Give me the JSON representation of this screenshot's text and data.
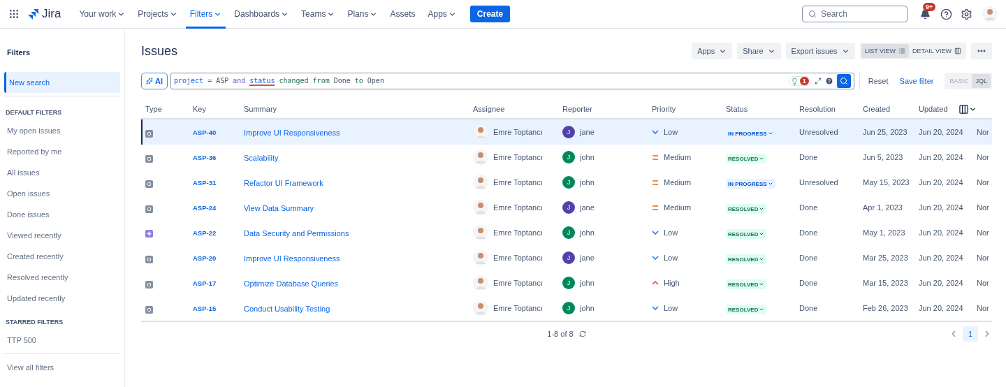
{
  "topbar": {
    "product": "Jira",
    "nav": [
      {
        "label": "Your work",
        "has_menu": true,
        "selected": false
      },
      {
        "label": "Projects",
        "has_menu": true,
        "selected": false
      },
      {
        "label": "Filters",
        "has_menu": true,
        "selected": true
      },
      {
        "label": "Dashboards",
        "has_menu": true,
        "selected": false
      },
      {
        "label": "Teams",
        "has_menu": true,
        "selected": false
      },
      {
        "label": "Plans",
        "has_menu": true,
        "selected": false
      },
      {
        "label": "Assets",
        "has_menu": false,
        "selected": false
      },
      {
        "label": "Apps",
        "has_menu": true,
        "selected": false
      }
    ],
    "create": "Create",
    "search": {
      "placeholder": "Search"
    },
    "notifications": "9+"
  },
  "sidebar": {
    "title": "Filters",
    "top": [
      {
        "label": "New search",
        "selected": true
      }
    ],
    "sections": [
      {
        "heading": "DEFAULT FILTERS",
        "items": [
          {
            "label": "My open issues",
            "selected": false
          },
          {
            "label": "Reported by me",
            "selected": false
          },
          {
            "label": "All issues",
            "selected": false
          },
          {
            "label": "Open issues",
            "selected": false
          },
          {
            "label": "Done issues",
            "selected": false
          },
          {
            "label": "Viewed recently",
            "selected": false
          },
          {
            "label": "Created recently",
            "selected": false
          },
          {
            "label": "Resolved recently",
            "selected": false
          },
          {
            "label": "Updated recently",
            "selected": false
          }
        ]
      },
      {
        "heading": "STARRED FILTERS",
        "items": [
          {
            "label": "TTP 500",
            "selected": false
          }
        ]
      }
    ],
    "footer": "View all filters"
  },
  "page": {
    "title": "Issues",
    "actions": [
      "Apps",
      "Share",
      "Export issues"
    ],
    "views": [
      {
        "label": "LIST VIEW",
        "kind": "list",
        "selected": true
      },
      {
        "label": "DETAIL VIEW",
        "kind": "detail",
        "selected": false
      }
    ]
  },
  "query": {
    "ai": "AI",
    "tokens": [
      {
        "text": "project",
        "kind": "field",
        "flagged": false
      },
      {
        "text": "=",
        "kind": "operator",
        "flagged": false
      },
      {
        "text": "ASP",
        "kind": "value",
        "flagged": false
      },
      {
        "text": "and",
        "kind": "keyword",
        "flagged": false
      },
      {
        "text": "status",
        "kind": "field",
        "flagged": true
      },
      {
        "text": "changed",
        "kind": "predicate",
        "flagged": false
      },
      {
        "text": "from",
        "kind": "predicate",
        "flagged": false
      },
      {
        "text": "Done",
        "kind": "value",
        "flagged": false
      },
      {
        "text": "to",
        "kind": "predicate",
        "flagged": false
      },
      {
        "text": "Open",
        "kind": "value",
        "flagged": false
      }
    ],
    "error_count": "1",
    "reset": "Reset",
    "save": "Save filter",
    "modes": [
      {
        "label": "BASIC",
        "selected": false
      },
      {
        "label": "JQL",
        "selected": true
      }
    ]
  },
  "table": {
    "columns": [
      "Type",
      "Key",
      "Summary",
      "Assignee",
      "Reporter",
      "Priority",
      "Status",
      "Resolution",
      "Created",
      "Updated"
    ],
    "rows": [
      {
        "type": {
          "kind": "task"
        },
        "key": "ASP-40",
        "summary": "Improve UI Responsiveness",
        "assignee": "Emre Toptancı",
        "reporter": {
          "name": "jane",
          "initial": "J",
          "color": "#5243aa"
        },
        "priority": {
          "label": "Low",
          "kind": "low"
        },
        "status": {
          "label": "IN PROGRESS",
          "kind": "in_progress"
        },
        "resolution": "Unresolved",
        "created": "Jun 25, 2023",
        "updated": "Jun 20, 2024",
        "column_11": "Nor",
        "selected": true
      },
      {
        "type": {
          "kind": "task"
        },
        "key": "ASP-36",
        "summary": "Scalability",
        "assignee": "Emre Toptancı",
        "reporter": {
          "name": "john",
          "initial": "J",
          "color": "#00875a"
        },
        "priority": {
          "label": "Medium",
          "kind": "medium"
        },
        "status": {
          "label": "RESOLVED",
          "kind": "resolved"
        },
        "resolution": "Done",
        "created": "Jun 5, 2023",
        "updated": "Jun 20, 2024",
        "column_11": "Nor",
        "selected": false
      },
      {
        "type": {
          "kind": "task"
        },
        "key": "ASP-31",
        "summary": "Refactor UI Framework",
        "assignee": "Emre Toptancı",
        "reporter": {
          "name": "john",
          "initial": "J",
          "color": "#00875a"
        },
        "priority": {
          "label": "Medium",
          "kind": "medium"
        },
        "status": {
          "label": "IN PROGRESS",
          "kind": "in_progress"
        },
        "resolution": "Unresolved",
        "created": "May 15, 2023",
        "updated": "Jun 20, 2024",
        "column_11": "Nor",
        "selected": false
      },
      {
        "type": {
          "kind": "task"
        },
        "key": "ASP-24",
        "summary": "View Data Summary",
        "assignee": "Emre Toptancı",
        "reporter": {
          "name": "jane",
          "initial": "J",
          "color": "#5243aa"
        },
        "priority": {
          "label": "Medium",
          "kind": "medium"
        },
        "status": {
          "label": "RESOLVED",
          "kind": "resolved"
        },
        "resolution": "Done",
        "created": "Apr 1, 2023",
        "updated": "Jun 20, 2024",
        "column_11": "Nor",
        "selected": false
      },
      {
        "type": {
          "kind": "epic"
        },
        "key": "ASP-22",
        "summary": "Data Security and Permissions",
        "assignee": "Emre Toptancı",
        "reporter": {
          "name": "john",
          "initial": "J",
          "color": "#00875a"
        },
        "priority": {
          "label": "Low",
          "kind": "low"
        },
        "status": {
          "label": "RESOLVED",
          "kind": "resolved"
        },
        "resolution": "Done",
        "created": "May 1, 2023",
        "updated": "Jun 20, 2024",
        "column_11": "Nor",
        "selected": false
      },
      {
        "type": {
          "kind": "task"
        },
        "key": "ASP-20",
        "summary": "Improve UI Responsiveness",
        "assignee": "Emre Toptancı",
        "reporter": {
          "name": "jane",
          "initial": "J",
          "color": "#5243aa"
        },
        "priority": {
          "label": "Low",
          "kind": "low"
        },
        "status": {
          "label": "RESOLVED",
          "kind": "resolved"
        },
        "resolution": "Done",
        "created": "Mar 25, 2023",
        "updated": "Jun 20, 2024",
        "column_11": "Nor",
        "selected": false
      },
      {
        "type": {
          "kind": "task"
        },
        "key": "ASP-17",
        "summary": "Optimize Database Queries",
        "assignee": "Emre Toptancı",
        "reporter": {
          "name": "john",
          "initial": "J",
          "color": "#00875a"
        },
        "priority": {
          "label": "High",
          "kind": "high"
        },
        "status": {
          "label": "RESOLVED",
          "kind": "resolved"
        },
        "resolution": "Done",
        "created": "Mar 15, 2023",
        "updated": "Jun 20, 2024",
        "column_11": "Nor",
        "selected": false
      },
      {
        "type": {
          "kind": "task"
        },
        "key": "ASP-15",
        "summary": "Conduct Usability Testing",
        "assignee": "Emre Toptancı",
        "reporter": {
          "name": "john",
          "initial": "J",
          "color": "#00875a"
        },
        "priority": {
          "label": "Low",
          "kind": "low"
        },
        "status": {
          "label": "RESOLVED",
          "kind": "resolved"
        },
        "resolution": "Done",
        "created": "Feb 26, 2023",
        "updated": "Jun 20, 2024",
        "column_11": "Nor",
        "selected": false
      }
    ]
  },
  "pagination": {
    "summary": "1-8 of 8",
    "pages": [
      {
        "label": "1",
        "selected": true
      }
    ]
  }
}
